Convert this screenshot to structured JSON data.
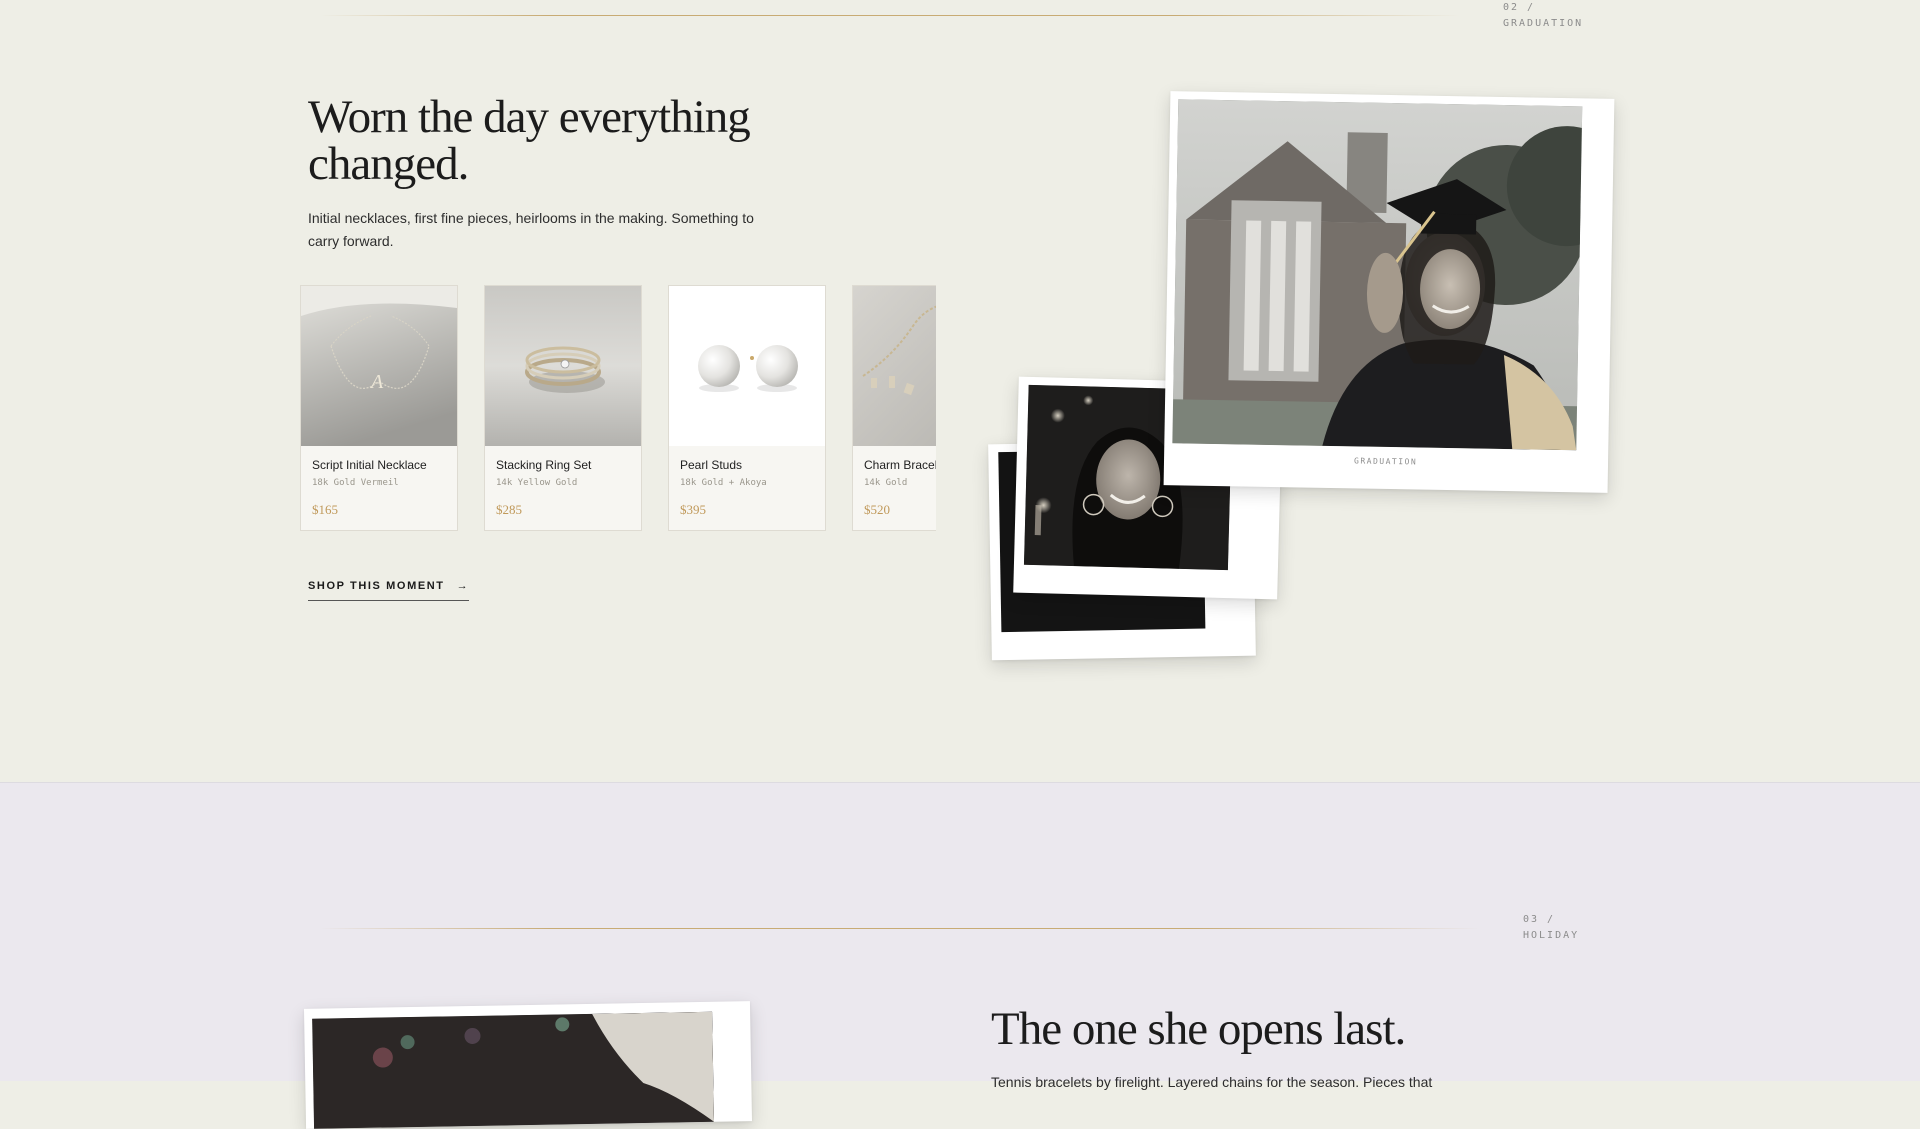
{
  "graduation": {
    "label": "02 / GRADUATION",
    "headline_line1": "Worn the day everything",
    "headline_line2": "changed.",
    "subcopy_line1": "Initial necklaces, first fine pieces, heirlooms in the making. Something to",
    "subcopy_line2": "carry forward.",
    "products": [
      {
        "name": "Script Initial Necklace",
        "material": "18k Gold Vermeil",
        "price": "$165"
      },
      {
        "name": "Stacking Ring Set",
        "material": "14k Yellow Gold",
        "price": "$285"
      },
      {
        "name": "Pearl Studs",
        "material": "18k Gold + Akoya",
        "price": "$395"
      },
      {
        "name": "Charm Bracelet",
        "material": "14k Gold",
        "price": "$520"
      }
    ],
    "cta": "SHOP THIS MOMENT",
    "cta_arrow": "→",
    "polaroid_caption": "GRADUATION"
  },
  "holiday": {
    "label": "03 / HOLIDAY",
    "headline": "The one she opens last.",
    "subcopy": "Tennis bracelets by firelight. Layered chains for the season. Pieces that"
  },
  "colors": {
    "accent_gold": "#c0995a",
    "background_top": "#eeeee6",
    "background_bottom": "#ebe8ee"
  }
}
